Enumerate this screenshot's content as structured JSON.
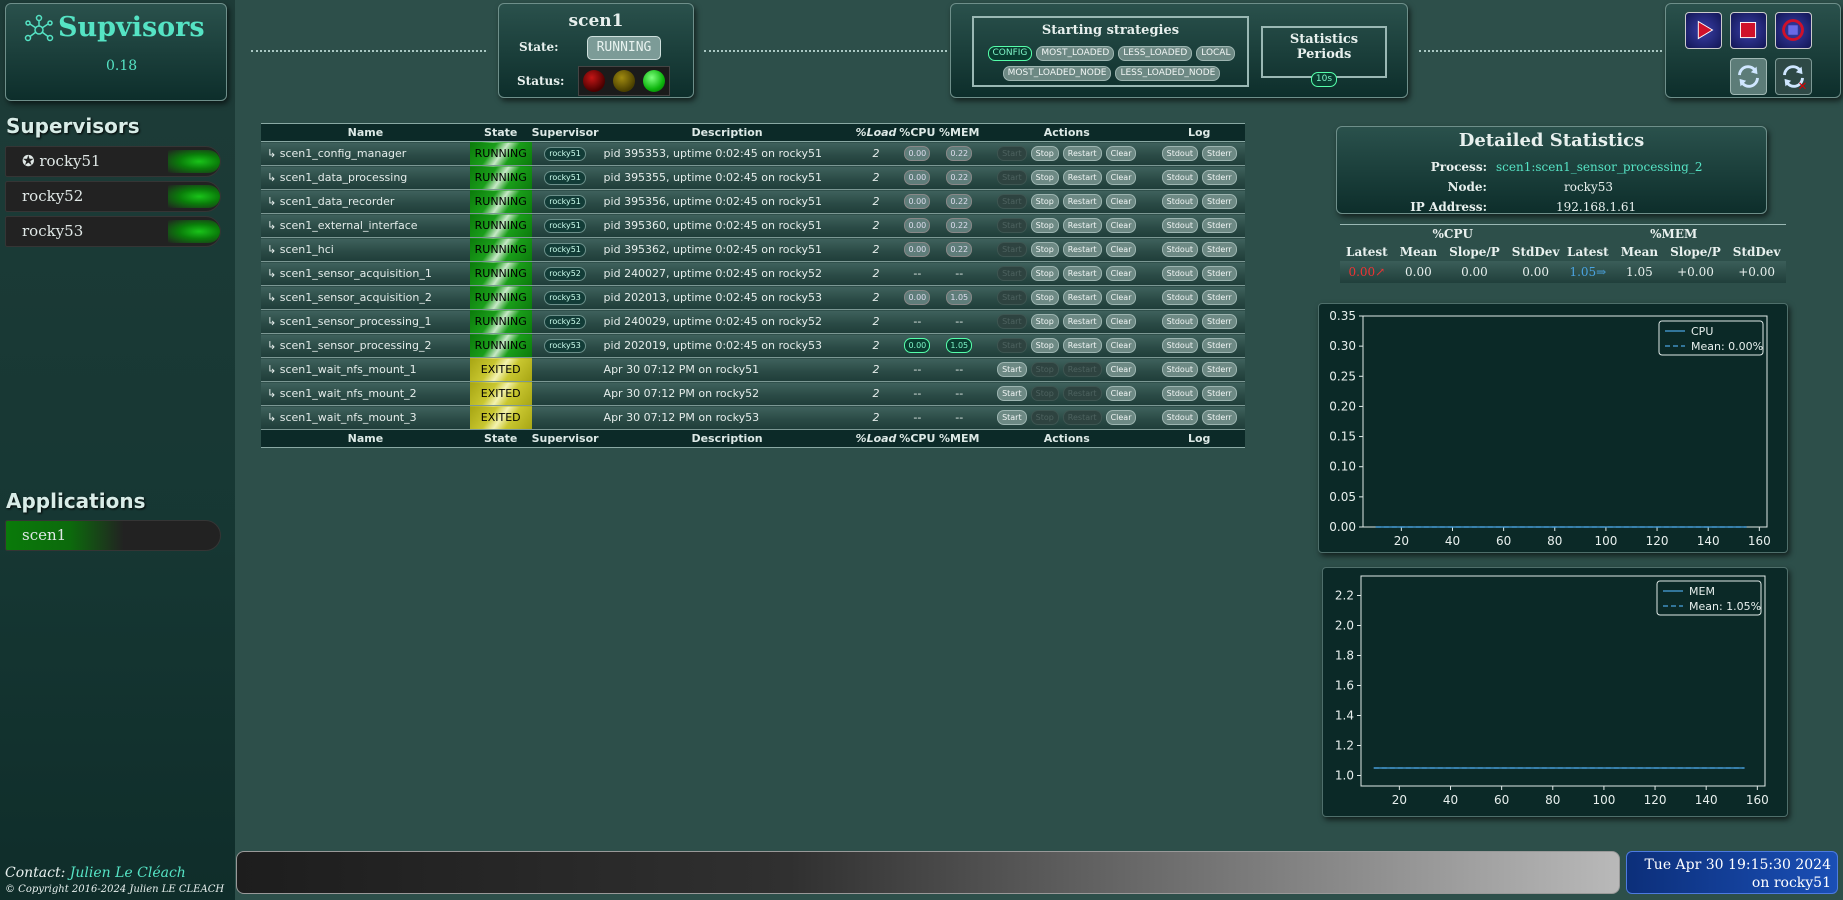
{
  "brand": {
    "title": "Supvisors",
    "version": "0.18",
    "logo_icon": "network-node-icon"
  },
  "sidebar": {
    "supervisors_title": "Supervisors",
    "supervisors": [
      {
        "label": "✪ rocky51",
        "status": "green"
      },
      {
        "label": "rocky52",
        "status": "green"
      },
      {
        "label": "rocky53",
        "status": "green"
      }
    ],
    "applications_title": "Applications",
    "applications": [
      {
        "label": "scen1"
      }
    ],
    "contact_label": "Contact:",
    "contact_name": "Julien Le Cléach",
    "copyright": "© Copyright 2016-2024 Julien LE CLEACH"
  },
  "app_header": {
    "name": "scen1",
    "state_label": "State:",
    "state_value": "RUNNING",
    "status_label": "Status:",
    "status_lights": [
      "red",
      "yellow",
      "green"
    ]
  },
  "strategies": {
    "title": "Starting strategies",
    "options": [
      "CONFIG",
      "MOST_LOADED",
      "LESS_LOADED",
      "LOCAL",
      "MOST_LOADED_NODE",
      "LESS_LOADED_NODE"
    ],
    "selected": "CONFIG"
  },
  "periods": {
    "title": "Statistics Periods",
    "options": [
      "10s"
    ],
    "selected": "10s"
  },
  "top_buttons": [
    "start-application-icon",
    "stop-application-icon",
    "restart-application-icon",
    "refresh-icon",
    "auto-refresh-icon"
  ],
  "process_table": {
    "headers": [
      "Name",
      "State",
      "Supervisor",
      "Description",
      "%Load",
      "%CPU",
      "%MEM",
      "Actions",
      "Log"
    ],
    "actions": [
      "Start",
      "Stop",
      "Restart",
      "Clear",
      "Stdout",
      "Stderr"
    ],
    "rows": [
      {
        "name": "↳ scen1_config_manager",
        "state": "RUNNING",
        "supervisor": "rocky51",
        "description": "pid 395353, uptime 0:02:45 on rocky51",
        "load": "2",
        "cpu": "0.00",
        "mem": "0.22"
      },
      {
        "name": "↳ scen1_data_processing",
        "state": "RUNNING",
        "supervisor": "rocky51",
        "description": "pid 395355, uptime 0:02:45 on rocky51",
        "load": "2",
        "cpu": "0.00",
        "mem": "0.22"
      },
      {
        "name": "↳ scen1_data_recorder",
        "state": "RUNNING",
        "supervisor": "rocky51",
        "description": "pid 395356, uptime 0:02:45 on rocky51",
        "load": "2",
        "cpu": "0.00",
        "mem": "0.22"
      },
      {
        "name": "↳ scen1_external_interface",
        "state": "RUNNING",
        "supervisor": "rocky51",
        "description": "pid 395360, uptime 0:02:45 on rocky51",
        "load": "2",
        "cpu": "0.00",
        "mem": "0.22"
      },
      {
        "name": "↳ scen1_hci",
        "state": "RUNNING",
        "supervisor": "rocky51",
        "description": "pid 395362, uptime 0:02:45 on rocky51",
        "load": "2",
        "cpu": "0.00",
        "mem": "0.22"
      },
      {
        "name": "↳ scen1_sensor_acquisition_1",
        "state": "RUNNING",
        "supervisor": "rocky52",
        "description": "pid 240027, uptime 0:02:45 on rocky52",
        "load": "2",
        "cpu": "--",
        "mem": "--"
      },
      {
        "name": "↳ scen1_sensor_acquisition_2",
        "state": "RUNNING",
        "supervisor": "rocky53",
        "description": "pid 202013, uptime 0:02:45 on rocky53",
        "load": "2",
        "cpu": "0.00",
        "mem": "1.05"
      },
      {
        "name": "↳ scen1_sensor_processing_1",
        "state": "RUNNING",
        "supervisor": "rocky52",
        "description": "pid 240029, uptime 0:02:45 on rocky52",
        "load": "2",
        "cpu": "--",
        "mem": "--"
      },
      {
        "name": "↳ scen1_sensor_processing_2",
        "state": "RUNNING",
        "supervisor": "rocky53",
        "description": "pid 202019, uptime 0:02:45 on rocky53",
        "load": "2",
        "cpu": "0.00",
        "mem": "1.05",
        "highlight": true
      },
      {
        "name": "↳ scen1_wait_nfs_mount_1",
        "state": "EXITED",
        "supervisor": "",
        "description": "Apr 30 07:12 PM on rocky51",
        "load": "2",
        "cpu": "--",
        "mem": "--"
      },
      {
        "name": "↳ scen1_wait_nfs_mount_2",
        "state": "EXITED",
        "supervisor": "",
        "description": "Apr 30 07:12 PM on rocky52",
        "load": "2",
        "cpu": "--",
        "mem": "--"
      },
      {
        "name": "↳ scen1_wait_nfs_mount_3",
        "state": "EXITED",
        "supervisor": "",
        "description": "Apr 30 07:12 PM on rocky53",
        "load": "2",
        "cpu": "--",
        "mem": "--"
      }
    ]
  },
  "detailed_stats": {
    "title": "Detailed Statistics",
    "process_label": "Process:",
    "process_value": "scen1:scen1_sensor_processing_2",
    "node_label": "Node:",
    "node_value": "rocky53",
    "ip_label": "IP Address:",
    "ip_value": "192.168.1.61",
    "cpu": {
      "title": "%CPU",
      "headers": [
        "Latest",
        "Mean",
        "Slope/P",
        "StdDev"
      ],
      "values": [
        "0.00↗",
        "0.00",
        "0.00",
        "0.00"
      ]
    },
    "mem": {
      "title": "%MEM",
      "headers": [
        "Latest",
        "Mean",
        "Slope/P",
        "StdDev"
      ],
      "values": [
        "1.05⇒",
        "1.05",
        "+0.00",
        "+0.00"
      ]
    }
  },
  "chart_data": [
    {
      "type": "line",
      "x": [
        10,
        20,
        30,
        40,
        50,
        60,
        70,
        80,
        90,
        100,
        110,
        120,
        130,
        140,
        150,
        155
      ],
      "series": [
        {
          "name": "CPU",
          "values": [
            0,
            0,
            0,
            0,
            0,
            0,
            0,
            0,
            0,
            0,
            0,
            0,
            0,
            0,
            0,
            0
          ]
        },
        {
          "name": "Mean: 0.00%",
          "values": [
            0,
            0,
            0,
            0,
            0,
            0,
            0,
            0,
            0,
            0,
            0,
            0,
            0,
            0,
            0,
            0
          ],
          "style": "dashed"
        }
      ],
      "xticks": [
        "20",
        "40",
        "60",
        "80",
        "100",
        "120",
        "140",
        "160"
      ],
      "yticks": [
        "0.00",
        "0.05",
        "0.10",
        "0.15",
        "0.20",
        "0.25",
        "0.30",
        "0.35"
      ],
      "xlim": [
        5,
        163
      ],
      "ylim": [
        0,
        0.35
      ],
      "legend": "top-right",
      "color": "#4aa3e0"
    },
    {
      "type": "line",
      "x": [
        10,
        20,
        30,
        40,
        50,
        60,
        70,
        80,
        90,
        100,
        110,
        120,
        130,
        140,
        150,
        155
      ],
      "series": [
        {
          "name": "MEM",
          "values": [
            1.05,
            1.05,
            1.05,
            1.05,
            1.05,
            1.05,
            1.05,
            1.05,
            1.05,
            1.05,
            1.05,
            1.05,
            1.05,
            1.05,
            1.05,
            1.05
          ]
        },
        {
          "name": "Mean: 1.05%",
          "values": [
            1.05,
            1.05,
            1.05,
            1.05,
            1.05,
            1.05,
            1.05,
            1.05,
            1.05,
            1.05,
            1.05,
            1.05,
            1.05,
            1.05,
            1.05,
            1.05
          ],
          "style": "dashed"
        }
      ],
      "xticks": [
        "20",
        "40",
        "60",
        "80",
        "100",
        "120",
        "140",
        "160"
      ],
      "yticks": [
        "1.0",
        "1.2",
        "1.4",
        "1.6",
        "1.8",
        "2.0",
        "2.2"
      ],
      "xlim": [
        5,
        163
      ],
      "ylim": [
        0.93,
        2.33
      ],
      "legend": "top-right",
      "color": "#4aa3e0"
    }
  ],
  "footer": {
    "date": "Tue Apr 30 19:15:30 2024",
    "node": "on rocky51"
  }
}
